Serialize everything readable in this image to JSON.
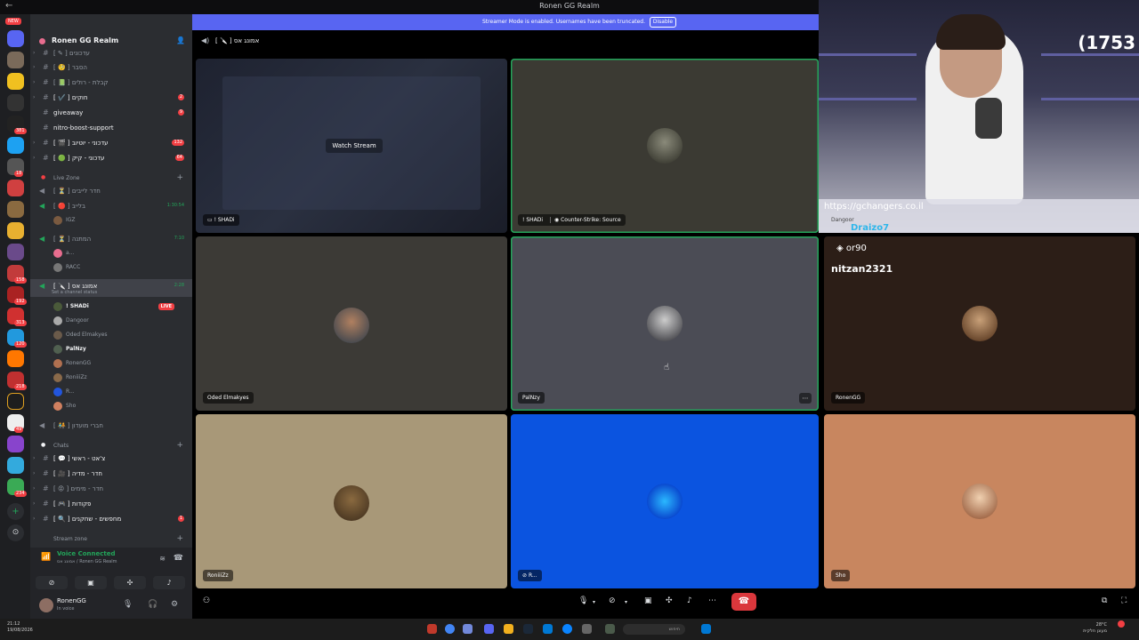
{
  "window": {
    "title": "Ronen GG Realm"
  },
  "rail": {
    "new_badge": "NEW",
    "badges": [
      "381",
      "18",
      "158",
      "192",
      "313",
      "120",
      "218",
      "49",
      "234"
    ]
  },
  "server": {
    "name": "Ronen GG Realm"
  },
  "channels": [
    {
      "label": "[ ✎ ] עדכונים",
      "badge": ""
    },
    {
      "label": "[ 🧐 ] הסבר",
      "badge": ""
    },
    {
      "label": "[ 📗 ] קבלת - רולים",
      "badge": ""
    },
    {
      "label": "[ ✔️ ] חוקים",
      "badge": "2"
    },
    {
      "label": "giveaway",
      "badge": "9"
    },
    {
      "label": "nitro-boost-support",
      "badge": ""
    },
    {
      "label": "[ 🎬 ] עדכוני - יוטיוב",
      "badge": "132"
    },
    {
      "label": "[ 🟢 ] עדכוני - קיק",
      "badge": "64"
    }
  ],
  "live_zone": {
    "category": "Live Zone",
    "voice_channels": [
      {
        "label": "[ ⏳ ] חדר לייבים",
        "time": ""
      },
      {
        "label": "[ 🔴 ] בלייב",
        "time": "1:30:54"
      }
    ],
    "bliv_member": "IGZ",
    "waiting_room": {
      "label": "[ ⏳ ] המתנה",
      "time": "7:10"
    },
    "waiting_members": [
      "a...",
      "RACC"
    ],
    "active_channel": {
      "label": "[ 🔪 ] אמונג אס",
      "time": "2:28",
      "status": "Set a channel status"
    },
    "members": [
      "! SHADi",
      "Dangoor",
      "Oded Elmakyes",
      "PalNzy",
      "RonenGG",
      "RoniiiZz",
      "R...",
      "Sho"
    ],
    "live_badge": "LIVE",
    "friends_room": "[ 🧑‍🤝‍🧑 ] חברי מועדון"
  },
  "chats": {
    "category": "Chats",
    "channels": [
      {
        "label": "[ 💬 ] צ'אט - ראשי",
        "badge": ""
      },
      {
        "label": "[ 🎥 ] חדר - מדיה",
        "badge": ""
      },
      {
        "label": "[ 😡 ] חדר - מימים",
        "badge": ""
      },
      {
        "label": "[ 🎮 ] פקודות",
        "badge": ""
      },
      {
        "label": "[ 🔍 ] מחפשים - שחקנים",
        "badge": "1"
      }
    ],
    "next_category": "Stream zone"
  },
  "voice_panel": {
    "status": "Voice Connected",
    "location": "אמונג אס / Ronen GG Realm"
  },
  "user_panel": {
    "name": "RonenGG",
    "status": "In voice"
  },
  "banner": {
    "text": "Streamer Mode is enabled. Usernames have been truncated.",
    "button": "Disable"
  },
  "channel_header": {
    "name": "[ 🔪 ] אמונג אס"
  },
  "tiles": [
    {
      "name": "! SHADi",
      "watch": "Watch Stream",
      "activity": ""
    },
    {
      "name": "! SHADi",
      "watch": "",
      "activity": "Counter-Strike: Source"
    },
    {
      "name": "Oded Elmakyes",
      "watch": "",
      "activity": ""
    },
    {
      "name": "PalNzy",
      "watch": "",
      "activity": ""
    },
    {
      "name": "RonenGG",
      "watch": "",
      "activity": ""
    },
    {
      "name": "RoniiiZz",
      "watch": "",
      "activity": ""
    },
    {
      "name": "R...",
      "watch": "",
      "activity": ""
    },
    {
      "name": "Sho",
      "watch": "",
      "activity": ""
    }
  ],
  "overlay": {
    "counter": "(1753",
    "url": "https://gchangers.co.il",
    "chat": [
      {
        "user": "Dangoor",
        "text": ""
      },
      {
        "user": "Draizo7",
        "text": ""
      },
      {
        "user": "or90",
        "text": ""
      },
      {
        "user": "nitzan2321",
        "text": ""
      }
    ]
  },
  "taskbar": {
    "time": "21:12",
    "date": "19/08/2026",
    "search": "חיפוש",
    "weather_temp": "28°C",
    "weather_desc": "מעונן חלקית"
  },
  "colors": {
    "blurple": "#5865f2",
    "green": "#23a55a",
    "red": "#f23f43",
    "bg_dark": "#1e1f22",
    "bg_side": "#2b2d31"
  }
}
